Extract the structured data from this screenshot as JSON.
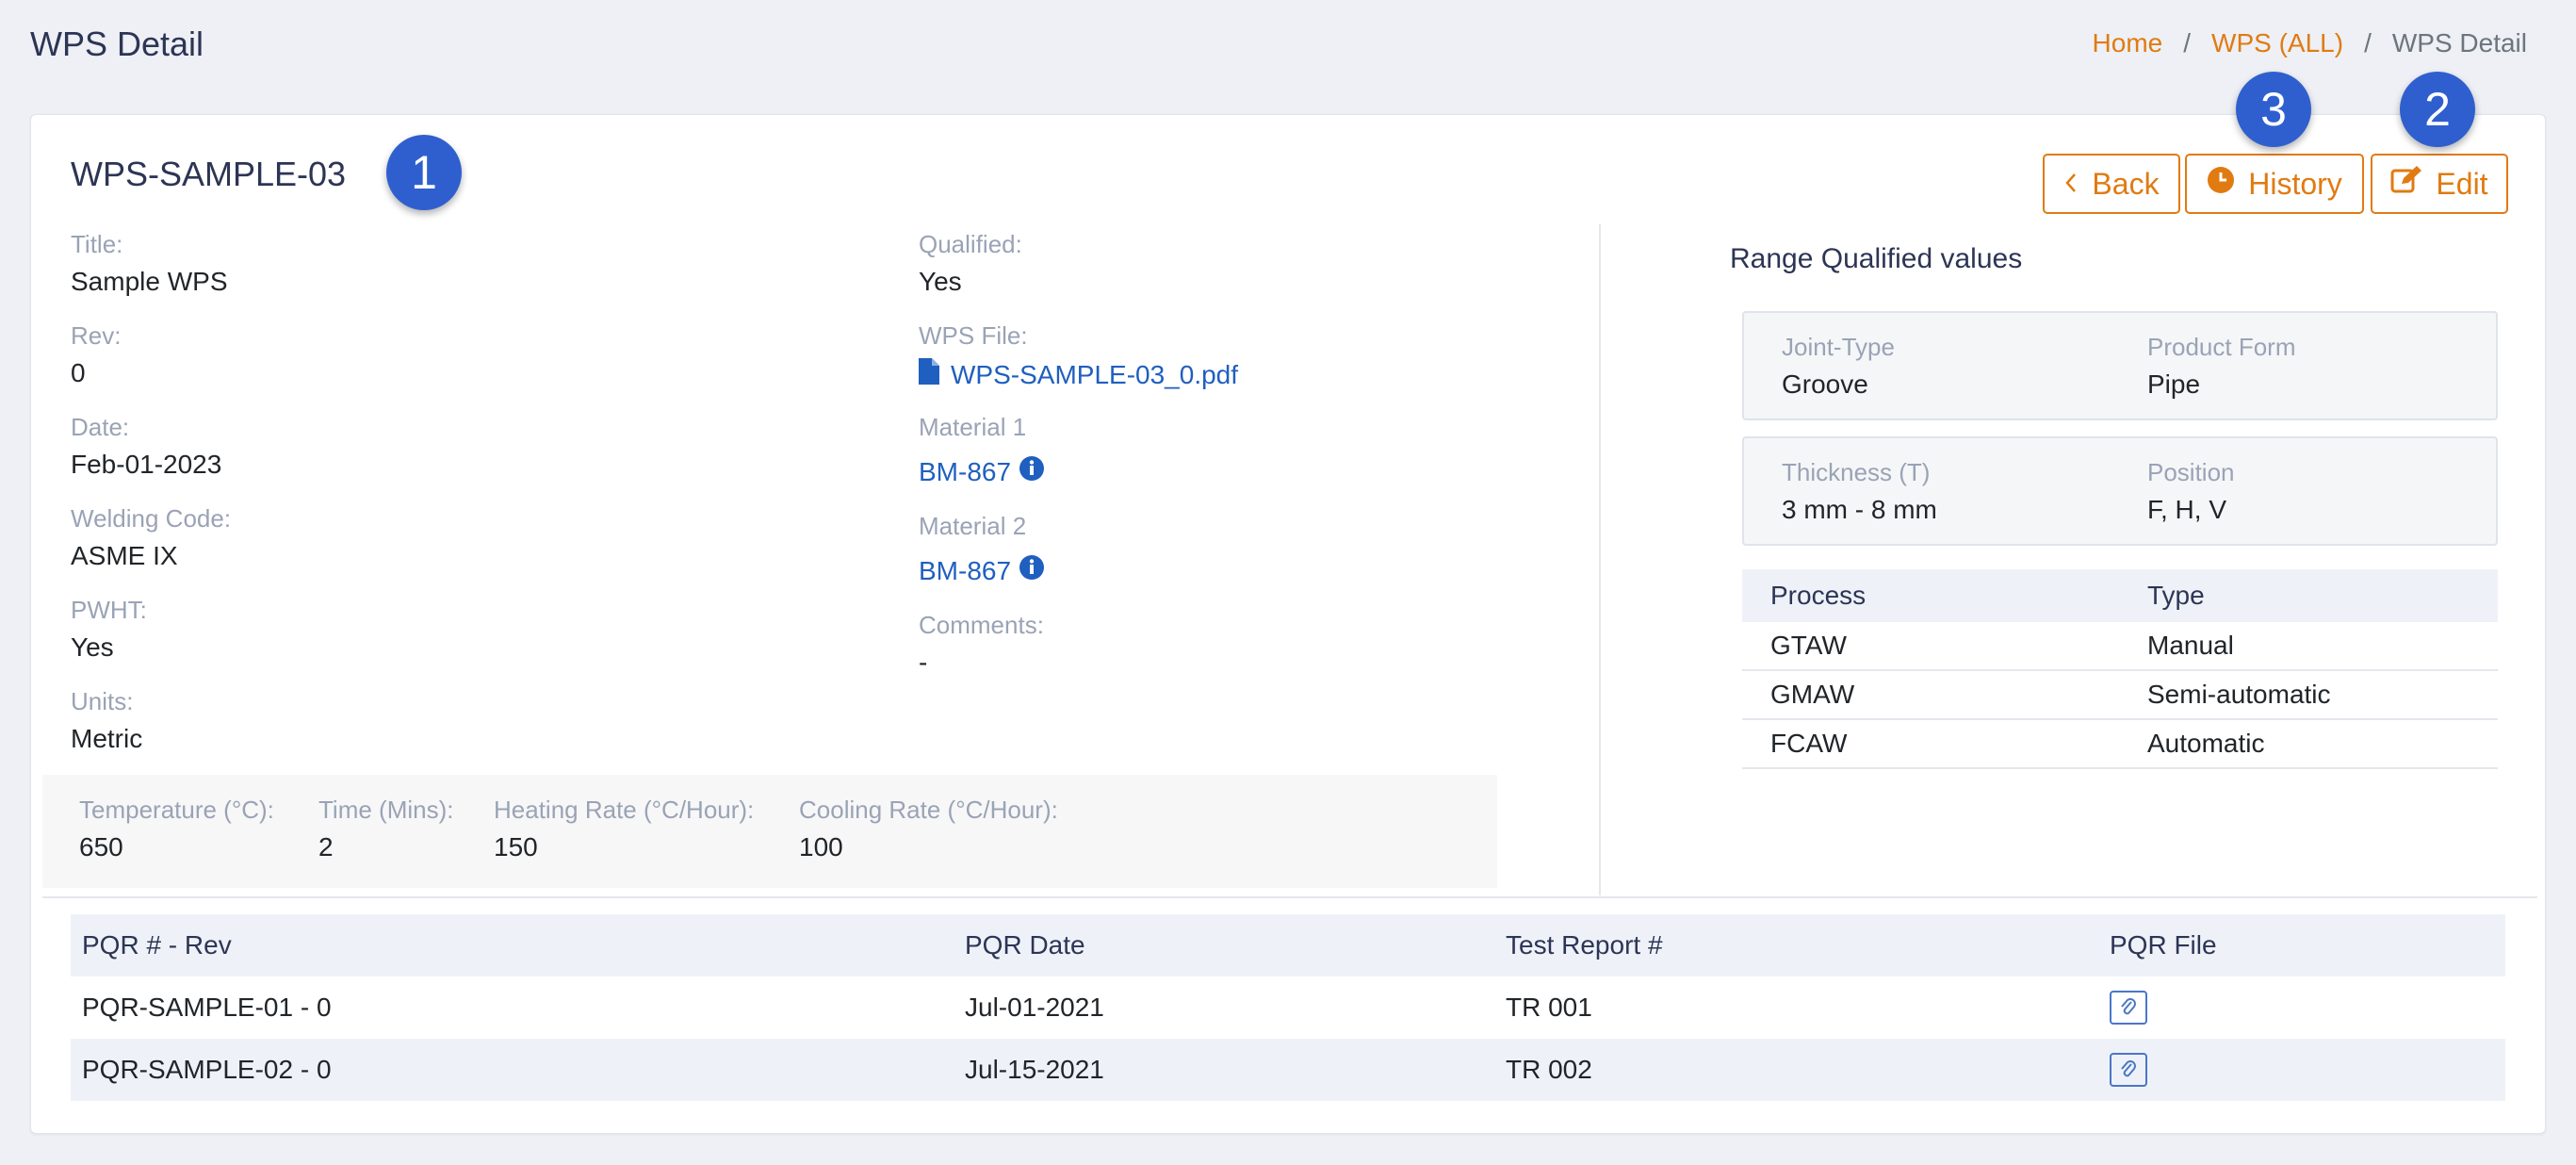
{
  "header": {
    "title": "WPS Detail",
    "breadcrumb": {
      "home": "Home",
      "sep1": "/",
      "list": "WPS (ALL)",
      "sep2": "/",
      "current": "WPS Detail"
    }
  },
  "wps": {
    "id": "WPS-SAMPLE-03",
    "title_label": "Title:",
    "title": "Sample WPS",
    "rev_label": "Rev:",
    "rev": "0",
    "date_label": "Date:",
    "date": "Feb-01-2023",
    "code_label": "Welding Code:",
    "code": "ASME IX",
    "pwht_label": "PWHT:",
    "pwht": "Yes",
    "units_label": "Units:",
    "units": "Metric",
    "qualified_label": "Qualified:",
    "qualified": "Yes",
    "file_label": "WPS File:",
    "file": "WPS-SAMPLE-03_0.pdf",
    "material1_label": "Material 1",
    "material1": "BM-867",
    "material2_label": "Material 2",
    "material2": "BM-867",
    "comments_label": "Comments:",
    "comments": "-"
  },
  "pwht_params": {
    "temp_label": "Temperature (°C):",
    "temp": "650",
    "time_label": "Time (Mins):",
    "time": "2",
    "heat_label": "Heating Rate (°C/Hour):",
    "heat": "150",
    "cool_label": "Cooling Rate (°C/Hour):",
    "cool": "100"
  },
  "buttons": {
    "back": "Back",
    "history": "History",
    "edit": "Edit"
  },
  "badges": {
    "one": "1",
    "two": "2",
    "three": "3"
  },
  "range": {
    "title": "Range Qualified values",
    "joint_label": "Joint-Type",
    "joint": "Groove",
    "form_label": "Product Form",
    "form": "Pipe",
    "thick_label": "Thickness (T)",
    "thick": "3 mm - 8 mm",
    "pos_label": "Position",
    "pos": "F, H, V",
    "process_headers": [
      "Process",
      "Type"
    ],
    "processes": [
      {
        "process": "GTAW",
        "type": "Manual"
      },
      {
        "process": "GMAW",
        "type": "Semi-automatic"
      },
      {
        "process": "FCAW",
        "type": "Automatic"
      }
    ]
  },
  "pqr": {
    "headers": [
      "PQR # - Rev",
      "PQR Date",
      "Test Report #",
      "PQR File"
    ],
    "rows": [
      {
        "pqr": "PQR-SAMPLE-01 - 0",
        "date": "Jul-01-2021",
        "report": "TR 001"
      },
      {
        "pqr": "PQR-SAMPLE-02 - 0",
        "date": "Jul-15-2021",
        "report": "TR 002"
      }
    ]
  },
  "colors": {
    "accent": "#e07b12",
    "link": "#1f5fbf",
    "badge": "#2f5fcf"
  },
  "icons": {
    "back": "chevron-left-icon",
    "history": "clock-icon",
    "edit": "edit-icon",
    "file": "file-icon",
    "info": "info-icon",
    "attachment": "paperclip-icon"
  }
}
